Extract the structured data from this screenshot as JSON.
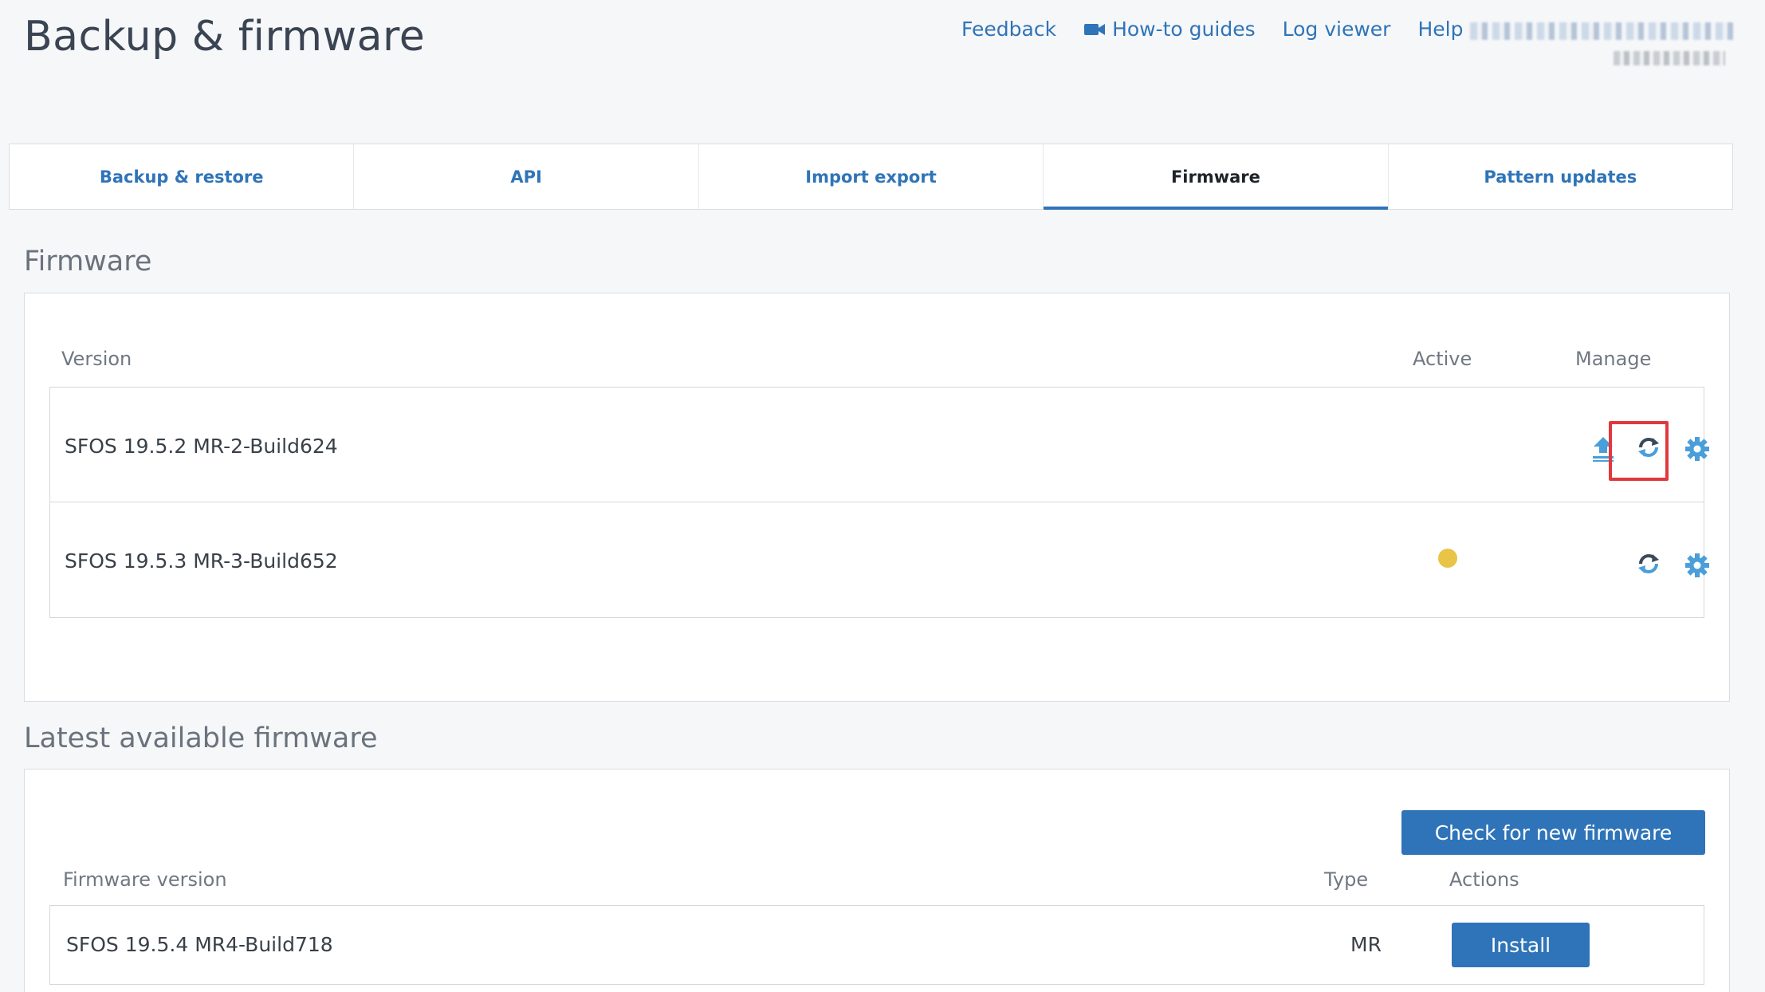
{
  "header": {
    "title": "Backup & firmware",
    "links": {
      "feedback": "Feedback",
      "howto": "How-to guides",
      "howto_icon": "video-camera-icon",
      "logviewer": "Log viewer",
      "help": "Help"
    }
  },
  "tabs": [
    {
      "label": "Backup & restore",
      "active": false
    },
    {
      "label": "API",
      "active": false
    },
    {
      "label": "Import export",
      "active": false
    },
    {
      "label": "Firmware",
      "active": true
    },
    {
      "label": "Pattern updates",
      "active": false
    }
  ],
  "firmware": {
    "section_title": "Firmware",
    "columns": {
      "version": "Version",
      "active": "Active",
      "manage": "Manage"
    },
    "rows": [
      {
        "version": "SFOS 19.5.2 MR-2-Build624",
        "active": false,
        "icons": [
          "upload-icon",
          "reboot-icon",
          "gear-icon"
        ]
      },
      {
        "version": "SFOS 19.5.3 MR-3-Build652",
        "active": true,
        "icons": [
          "reboot-icon",
          "gear-icon"
        ]
      }
    ],
    "highlight_color": "#e0383e",
    "active_color": "#e8c447"
  },
  "latest": {
    "section_title": "Latest available firmware",
    "check_button": "Check for new firmware",
    "columns": {
      "version": "Firmware version",
      "type": "Type",
      "actions": "Actions"
    },
    "rows": [
      {
        "version": "SFOS 19.5.4 MR4-Build718",
        "type": "MR",
        "action": "Install"
      }
    ]
  },
  "colors": {
    "accent": "#2f74b8",
    "background": "#f6f7f9"
  }
}
